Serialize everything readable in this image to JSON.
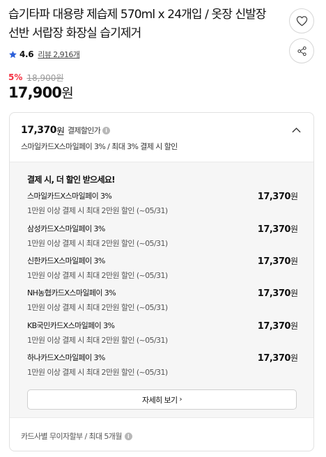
{
  "product": {
    "title": "습기타파 대용량 제습제 570ml x 24개입 / 옷장 신발장 선반 서랍장 화장실 습기제거",
    "rating": "4.6",
    "review_text": "리뷰 2,916개",
    "discount_rate": "5%",
    "original_price": "18,900원",
    "price": "17,900",
    "price_unit": "원"
  },
  "actions": {
    "like_icon": "heart-icon",
    "share_icon": "share-icon"
  },
  "payment_card": {
    "price": "17,370",
    "price_unit": "원",
    "label": "결제할인가",
    "subtitle": "스마일카드X스마일페이 3% / 최대 3% 결제 시 할인",
    "benefit_title": "결제 시, 더 할인 받으세요!",
    "benefits": [
      {
        "name": "스마일카드X스마일페이 3%",
        "desc": "1만원 이상 결제 시 최대 2만원 할인 (~05/31)",
        "amount": "17,370",
        "unit": "원"
      },
      {
        "name": "삼성카드X스마일페이 3%",
        "desc": "1만원 이상 결제 시 최대 2만원 할인 (~05/31)",
        "amount": "17,370",
        "unit": "원"
      },
      {
        "name": "신한카드X스마일페이 3%",
        "desc": "1만원 이상 결제 시 최대 2만원 할인 (~05/31)",
        "amount": "17,370",
        "unit": "원"
      },
      {
        "name": "NH농협카드X스마일페이 3%",
        "desc": "1만원 이상 결제 시 최대 2만원 할인 (~05/31)",
        "amount": "17,370",
        "unit": "원"
      },
      {
        "name": "KB국민카드X스마일페이 3%",
        "desc": "1만원 이상 결제 시 최대 2만원 할인 (~05/31)",
        "amount": "17,370",
        "unit": "원"
      },
      {
        "name": "하나카드X스마일페이 3%",
        "desc": "1만원 이상 결제 시 최대 2만원 할인 (~05/31)",
        "amount": "17,370",
        "unit": "원"
      }
    ],
    "detail_button": "자세히 보기",
    "installment_text": "카드사별 무이자할부 / 최대 5개월"
  },
  "colors": {
    "discount": "#f43142",
    "star": "#2b5fd9",
    "text": "#111111",
    "muted": "#9a9a9a",
    "panel_bg": "#f6f6f6"
  }
}
